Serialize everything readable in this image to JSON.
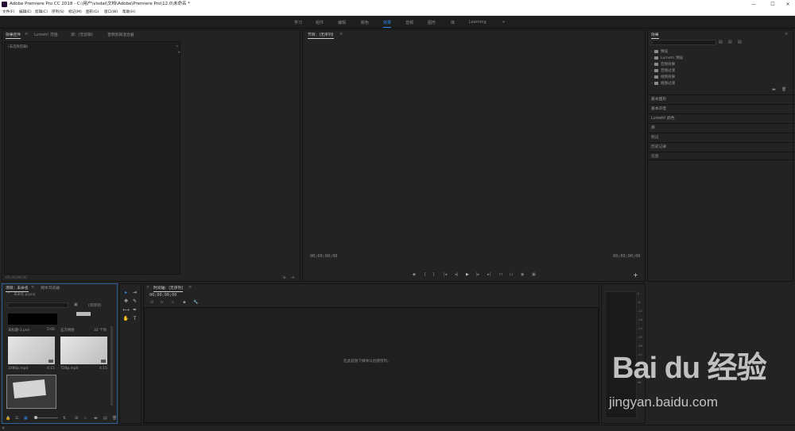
{
  "titlebar": {
    "title": "Adobe Premiere Pro CC 2018 - C:\\用户\\visdai\\文档\\Adobe\\Premiere Pro\\12.0\\未命名 *",
    "minimize": "—",
    "maximize": "☐",
    "close": "✕"
  },
  "menubar": {
    "items": [
      "文件(F)",
      "编辑(E)",
      "剪辑(C)",
      "序列(S)",
      "标记(M)",
      "图形(G)",
      "窗口(W)",
      "帮助(H)"
    ]
  },
  "workspaces": {
    "items": [
      "学习",
      "组件",
      "编辑",
      "颜色",
      "效果",
      "音频",
      "图形",
      "库",
      "Learning"
    ],
    "active": "效果",
    "more": "»"
  },
  "source_panel": {
    "tabs": [
      "效果控件",
      "Lumetri 范围",
      "源：(无剪辑)",
      "音频剪辑混合器"
    ],
    "subheader": "(未选择剪辑)",
    "footer_time": "00;00;00;00"
  },
  "program_panel": {
    "title": "节目：(无序列)",
    "timecode_left": "00;00;00;00",
    "timecode_right": "00;00;00;00",
    "add": "+"
  },
  "effects_panel": {
    "title": "效果",
    "tree": [
      "预设",
      "Lumetri 预设",
      "音频效果",
      "音频过渡",
      "视频效果",
      "视频过渡"
    ],
    "sections": [
      "基本图形",
      "基本声音",
      "Lumetri 颜色",
      "库",
      "标记",
      "历史记录",
      "信息"
    ]
  },
  "project_panel": {
    "tabs": [
      "项目：未命名",
      "媒体浏览器"
    ],
    "file": "未命名.prproj",
    "items_count": "(项目项)",
    "items": [
      {
        "name": "未标题-1.psd",
        "duration": "5:00"
      },
      {
        "name": "五方格图",
        "duration": "32 个项"
      },
      {
        "name": "1080p.mp4",
        "duration": "4:15"
      },
      {
        "name": "720p.mp4",
        "duration": "4:15"
      }
    ]
  },
  "timeline_panel": {
    "title": "时间轴：(无序列)",
    "timecode": "00;00;00;00",
    "empty_message": "在此处放下媒体以创建序列。"
  },
  "audio_meter": {
    "ticks": [
      "0",
      "-6",
      "-12",
      "-18",
      "-24",
      "-30",
      "-36",
      "-42",
      "-48",
      "-54",
      "dB"
    ]
  },
  "watermark": {
    "logo": "Bai du 经验",
    "url": "jingyan.baidu.com"
  },
  "colors": {
    "accent": "#2d8ceb",
    "panel": "#232323",
    "dark": "#1d1d1d"
  }
}
